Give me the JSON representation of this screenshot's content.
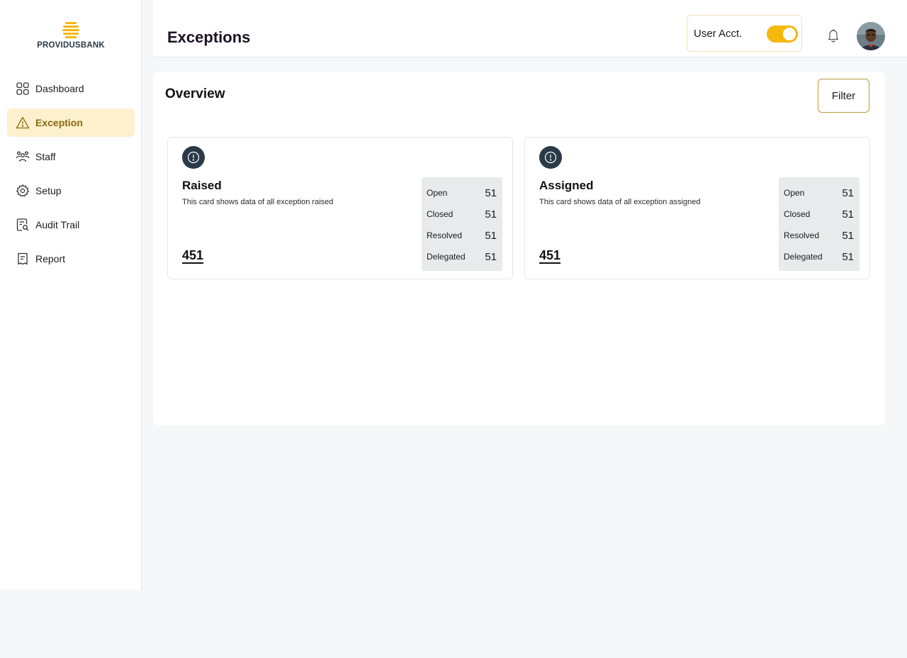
{
  "brand": {
    "name": "PROVIDUSBANK",
    "color": "#f5b80c"
  },
  "sidebar": {
    "items": [
      {
        "label": "Dashboard",
        "icon": "grid-icon"
      },
      {
        "label": "Exception",
        "icon": "warning-icon",
        "active": true
      },
      {
        "label": "Staff",
        "icon": "users-icon"
      },
      {
        "label": "Setup",
        "icon": "gear-icon"
      },
      {
        "label": "Audit Trail",
        "icon": "audit-icon"
      },
      {
        "label": "Report",
        "icon": "report-icon"
      }
    ]
  },
  "header": {
    "title": "Exceptions",
    "user_toggle_label": "User Acct.",
    "user_toggle_on": true
  },
  "overview": {
    "title": "Overview",
    "filter_label": "Filter",
    "cards": [
      {
        "title": "Raised",
        "description": "This card shows data of all exception raised",
        "total": "451",
        "stats": [
          {
            "label": "Open",
            "value": "51"
          },
          {
            "label": "Closed",
            "value": "51"
          },
          {
            "label": "Resolved",
            "value": "51"
          },
          {
            "label": "Delegated",
            "value": "51"
          }
        ]
      },
      {
        "title": "Assigned",
        "description": "This card shows data of all exception assigned",
        "total": "451",
        "stats": [
          {
            "label": "Open",
            "value": "51"
          },
          {
            "label": "Closed",
            "value": "51"
          },
          {
            "label": "Resolved",
            "value": "51"
          },
          {
            "label": "Delegated",
            "value": "51"
          }
        ]
      }
    ]
  }
}
